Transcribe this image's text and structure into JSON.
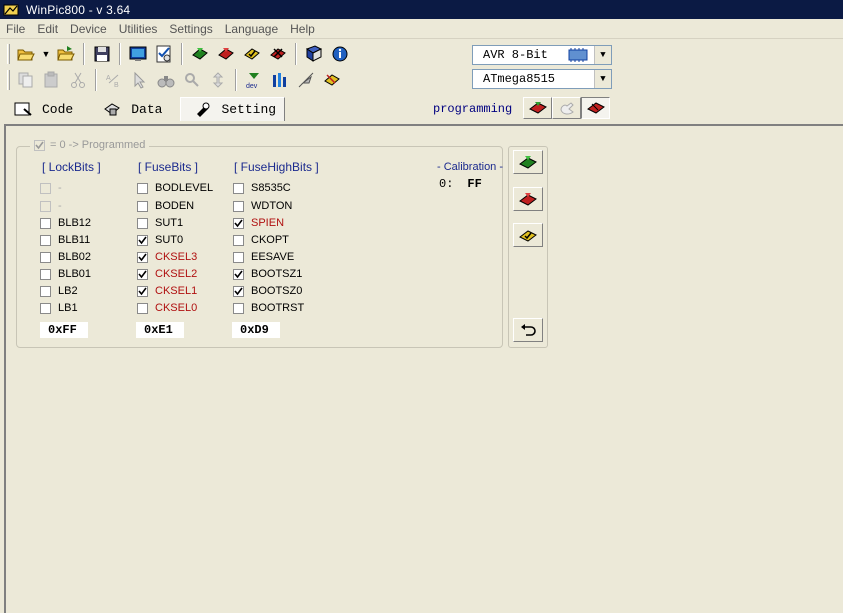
{
  "window": {
    "title": "WinPic800   -  v 3.64"
  },
  "menu": [
    "File",
    "Edit",
    "Device",
    "Utilities",
    "Settings",
    "Language",
    "Help"
  ],
  "device": {
    "family": "AVR 8-Bit",
    "chip": "ATmega8515"
  },
  "tabs": [
    {
      "label": "Code",
      "active": false
    },
    {
      "label": "Data",
      "active": false
    },
    {
      "label": "Setting",
      "active": true
    }
  ],
  "programming_label": "programming",
  "settings": {
    "legend": "= 0 -> Programmed",
    "lockbits": {
      "header": "[ LockBits ]",
      "bits": [
        {
          "label": "-",
          "checked": false,
          "enabled": false,
          "red": false
        },
        {
          "label": "-",
          "checked": false,
          "enabled": false,
          "red": false
        },
        {
          "label": "BLB12",
          "checked": false,
          "enabled": true,
          "red": false
        },
        {
          "label": "BLB11",
          "checked": false,
          "enabled": true,
          "red": false
        },
        {
          "label": "BLB02",
          "checked": false,
          "enabled": true,
          "red": false
        },
        {
          "label": "BLB01",
          "checked": false,
          "enabled": true,
          "red": false
        },
        {
          "label": "LB2",
          "checked": false,
          "enabled": true,
          "red": false
        },
        {
          "label": "LB1",
          "checked": false,
          "enabled": true,
          "red": false
        }
      ],
      "hex": "0xFF"
    },
    "fusebits": {
      "header": "[ FuseBits ]",
      "bits": [
        {
          "label": "BODLEVEL",
          "checked": false,
          "enabled": true,
          "red": false
        },
        {
          "label": "BODEN",
          "checked": false,
          "enabled": true,
          "red": false
        },
        {
          "label": "SUT1",
          "checked": false,
          "enabled": true,
          "red": false
        },
        {
          "label": "SUT0",
          "checked": true,
          "enabled": true,
          "red": false
        },
        {
          "label": "CKSEL3",
          "checked": true,
          "enabled": true,
          "red": true
        },
        {
          "label": "CKSEL2",
          "checked": true,
          "enabled": true,
          "red": true
        },
        {
          "label": "CKSEL1",
          "checked": true,
          "enabled": true,
          "red": true
        },
        {
          "label": "CKSEL0",
          "checked": false,
          "enabled": true,
          "red": true
        }
      ],
      "hex": "0xE1"
    },
    "fusehighbits": {
      "header": "[ FuseHighBits ]",
      "bits": [
        {
          "label": "S8535C",
          "checked": false,
          "enabled": true,
          "red": false
        },
        {
          "label": "WDTON",
          "checked": false,
          "enabled": true,
          "red": false
        },
        {
          "label": "SPIEN",
          "checked": true,
          "enabled": true,
          "red": true
        },
        {
          "label": "CKOPT",
          "checked": false,
          "enabled": true,
          "red": false
        },
        {
          "label": "EESAVE",
          "checked": false,
          "enabled": true,
          "red": false
        },
        {
          "label": "BOOTSZ1",
          "checked": true,
          "enabled": true,
          "red": false
        },
        {
          "label": "BOOTSZ0",
          "checked": true,
          "enabled": true,
          "red": false
        },
        {
          "label": "BOOTRST",
          "checked": false,
          "enabled": true,
          "red": false
        }
      ],
      "hex": "0xD9"
    },
    "calibration": {
      "header": "- Calibration -",
      "index": "0:",
      "value": "FF"
    }
  },
  "colors": {
    "titlebar": "#0b1a44",
    "header_blue": "#1b2a8e",
    "red_bit": "#b01010"
  }
}
